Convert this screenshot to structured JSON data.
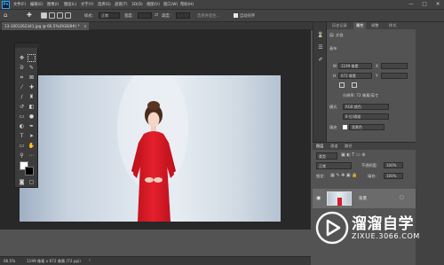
{
  "app": {
    "logo": "Ps"
  },
  "menu": [
    "文件(F)",
    "编辑(E)",
    "图像(I)",
    "图层(L)",
    "文字(Y)",
    "选择(S)",
    "滤镜(T)",
    "3D(D)",
    "视图(V)",
    "窗口(W)",
    "帮助(H)"
  ],
  "window_controls": {
    "minimize": "—",
    "maximize": "□",
    "close": "✕"
  },
  "options": {
    "style_label": "样式:",
    "style_value": "正常",
    "width_label": "宽度:",
    "height_label": "高度:",
    "select_subject": "选择并遮住...",
    "auto_label": "自动对齐"
  },
  "document": {
    "tab_title": "13-1001262341.jpg @ 66.5%(RGB/8#) *",
    "close": "×"
  },
  "status": {
    "zoom": "66.5%",
    "doc_info": "1199 像素 x 672 像素 (72 ppi)"
  },
  "properties": {
    "tabs": [
      "历史记录",
      "属性",
      "调整",
      "样式"
    ],
    "doc_label": "文档",
    "canvas_label": "画布",
    "w_label": "W",
    "w_value": "1199 像素",
    "x_label": "X",
    "h_label": "H",
    "h_value": "672 像素",
    "y_label": "Y",
    "resolution": "分辨率: 72 像素/英寸",
    "mode_label": "模式",
    "mode_value": "RGB 颜色",
    "bit_value": "8 位/通道",
    "fill_label": "填充",
    "fill_value": "背景色"
  },
  "layers": {
    "tabs": [
      "图层",
      "通道",
      "路径"
    ],
    "kind_label": "类型",
    "blend_value": "正常",
    "opacity_label": "不透明度:",
    "opacity_value": "100%",
    "lock_label": "锁定:",
    "fill_label": "填充:",
    "fill_value": "100%",
    "layer_name": "背景"
  },
  "watermark": {
    "brand": "溜溜自学",
    "url": "ZIXUE.3066.COM"
  }
}
